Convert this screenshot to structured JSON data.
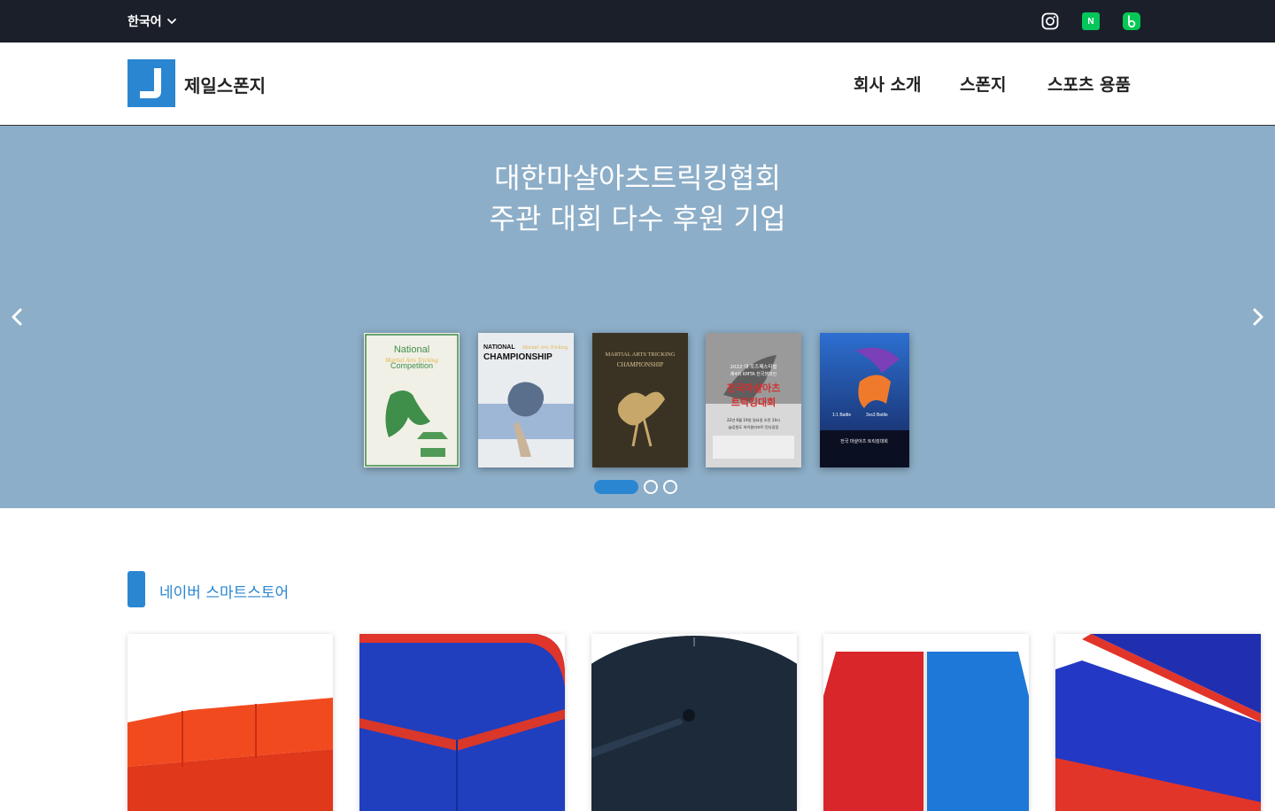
{
  "topbar": {
    "language": "한국어",
    "social": [
      "instagram-icon",
      "naver-icon",
      "band-icon"
    ],
    "naver_letter": "N"
  },
  "header": {
    "brand": "제일스폰지",
    "nav": [
      "회사 소개",
      "스폰지",
      "스포츠 용품"
    ]
  },
  "hero": {
    "title_line1": "대한마샬아츠트릭킹협회",
    "title_line2": "주관 대회 다수 후원 기업",
    "slides": 3,
    "active_slide": 1,
    "posters": [
      {
        "title_lines": [
          "National",
          "Martial Arts Tricking",
          "Competition"
        ]
      },
      {
        "title_lines": [
          "NATIONAL",
          "Martial Arts Tricking",
          "CHAMPIONSHIP"
        ]
      },
      {
        "title_lines": [
          "MARTIAL ARTS TRICKING",
          "CHAMPIONSHIP"
        ]
      },
      {
        "title_lines": [
          "2022 대·포즈페스티벌",
          "제4회 KMTA 전국챔피언",
          "전국마샬아츠",
          "트릭킹대회",
          "22년 6월 19일 일요일 오전 10시",
          "@강원도 하이원리조트 탄다광장"
        ]
      },
      {
        "title_lines": [
          "1:1 Battle",
          "3vs3 Battle",
          "전국 마샬아츠 트릭킹대회"
        ]
      }
    ]
  },
  "section": {
    "title": "네이버 스마트스토어"
  },
  "colors": {
    "accent": "#2a86d1",
    "topbar": "#1b1f2a",
    "hero_bg": "#8daec8"
  }
}
